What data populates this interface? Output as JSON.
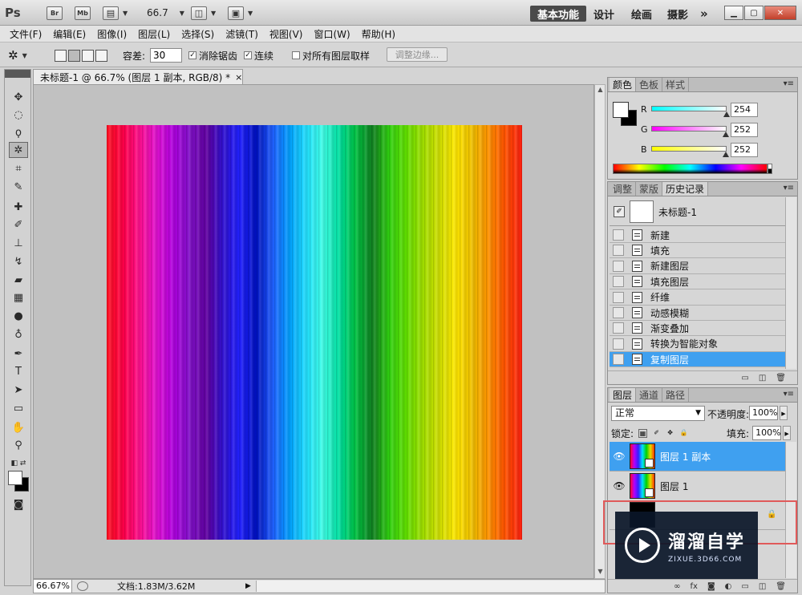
{
  "titlebar": {
    "logo": "Ps",
    "bridge_label": "Br",
    "minibridge_label": "Mb",
    "zoom": "66.7",
    "workspaces": [
      "基本功能",
      "设计",
      "绘画",
      "摄影"
    ],
    "more_label": "»"
  },
  "menu": [
    "文件(F)",
    "编辑(E)",
    "图像(I)",
    "图层(L)",
    "选择(S)",
    "滤镜(T)",
    "视图(V)",
    "窗口(W)",
    "帮助(H)"
  ],
  "options": {
    "tolerance_label": "容差:",
    "tolerance_value": "30",
    "antialias_label": "消除锯齿",
    "contiguous_label": "连续",
    "sample_all_label": "对所有图层取样",
    "refine_label": "调整边缘..."
  },
  "document": {
    "tab_title": "未标题-1 @ 66.7% (图层 1 副本, RGB/8) *",
    "close_symbol": "×",
    "zoom": "66.67%",
    "status": "文档:1.83M/3.62M",
    "canvas_stripes": [
      "#ff1020",
      "#ff0048",
      "#ff1090",
      "#e010d0",
      "#b000e0",
      "#8010c8",
      "#6000a0",
      "#3010d0",
      "#2020ff",
      "#0010c0",
      "#2060ff",
      "#00a0ff",
      "#20e0ff",
      "#40ffe8",
      "#00e0a0",
      "#00c040",
      "#108020",
      "#30d010",
      "#60e000",
      "#a0e000",
      "#d0e000",
      "#ffe800",
      "#f0c000",
      "#ff9000",
      "#ff5000",
      "#ff2010"
    ]
  },
  "color_panel": {
    "tabs": [
      "颜色",
      "色板",
      "样式"
    ],
    "channels": [
      {
        "label": "R",
        "value": "254",
        "fraction": 0.996,
        "gradient": [
          "#00ffff",
          "#ffffff"
        ]
      },
      {
        "label": "G",
        "value": "252",
        "fraction": 0.988,
        "gradient": [
          "#ff00ff",
          "#ffffff"
        ]
      },
      {
        "label": "B",
        "value": "252",
        "fraction": 0.988,
        "gradient": [
          "#ffff00",
          "#ffffff"
        ]
      }
    ]
  },
  "history_panel": {
    "tabs": [
      "调整",
      "蒙版",
      "历史记录"
    ],
    "snapshot": "未标题-1",
    "items": [
      "新建",
      "填充",
      "新建图层",
      "填充图层",
      "纤维",
      "动感模糊",
      "渐变叠加",
      "转换为智能对象",
      "复制图层"
    ],
    "selected_index": 8
  },
  "layers_panel": {
    "tabs": [
      "图层",
      "通道",
      "路径"
    ],
    "blend_mode": "正常",
    "opacity_label": "不透明度:",
    "opacity_value": "100%",
    "lock_label": "锁定:",
    "fill_label": "填充:",
    "fill_value": "100%",
    "layers": [
      {
        "name": "图层 1 副本",
        "selected": true
      },
      {
        "name": "图层 1",
        "selected": false
      }
    ]
  },
  "watermark": {
    "title": "溜溜自学",
    "url": "ZIXUE.3D66.COM"
  },
  "colors": {
    "selection_blue": "#3fa0f0",
    "highlight_red": "#e05a5a"
  }
}
